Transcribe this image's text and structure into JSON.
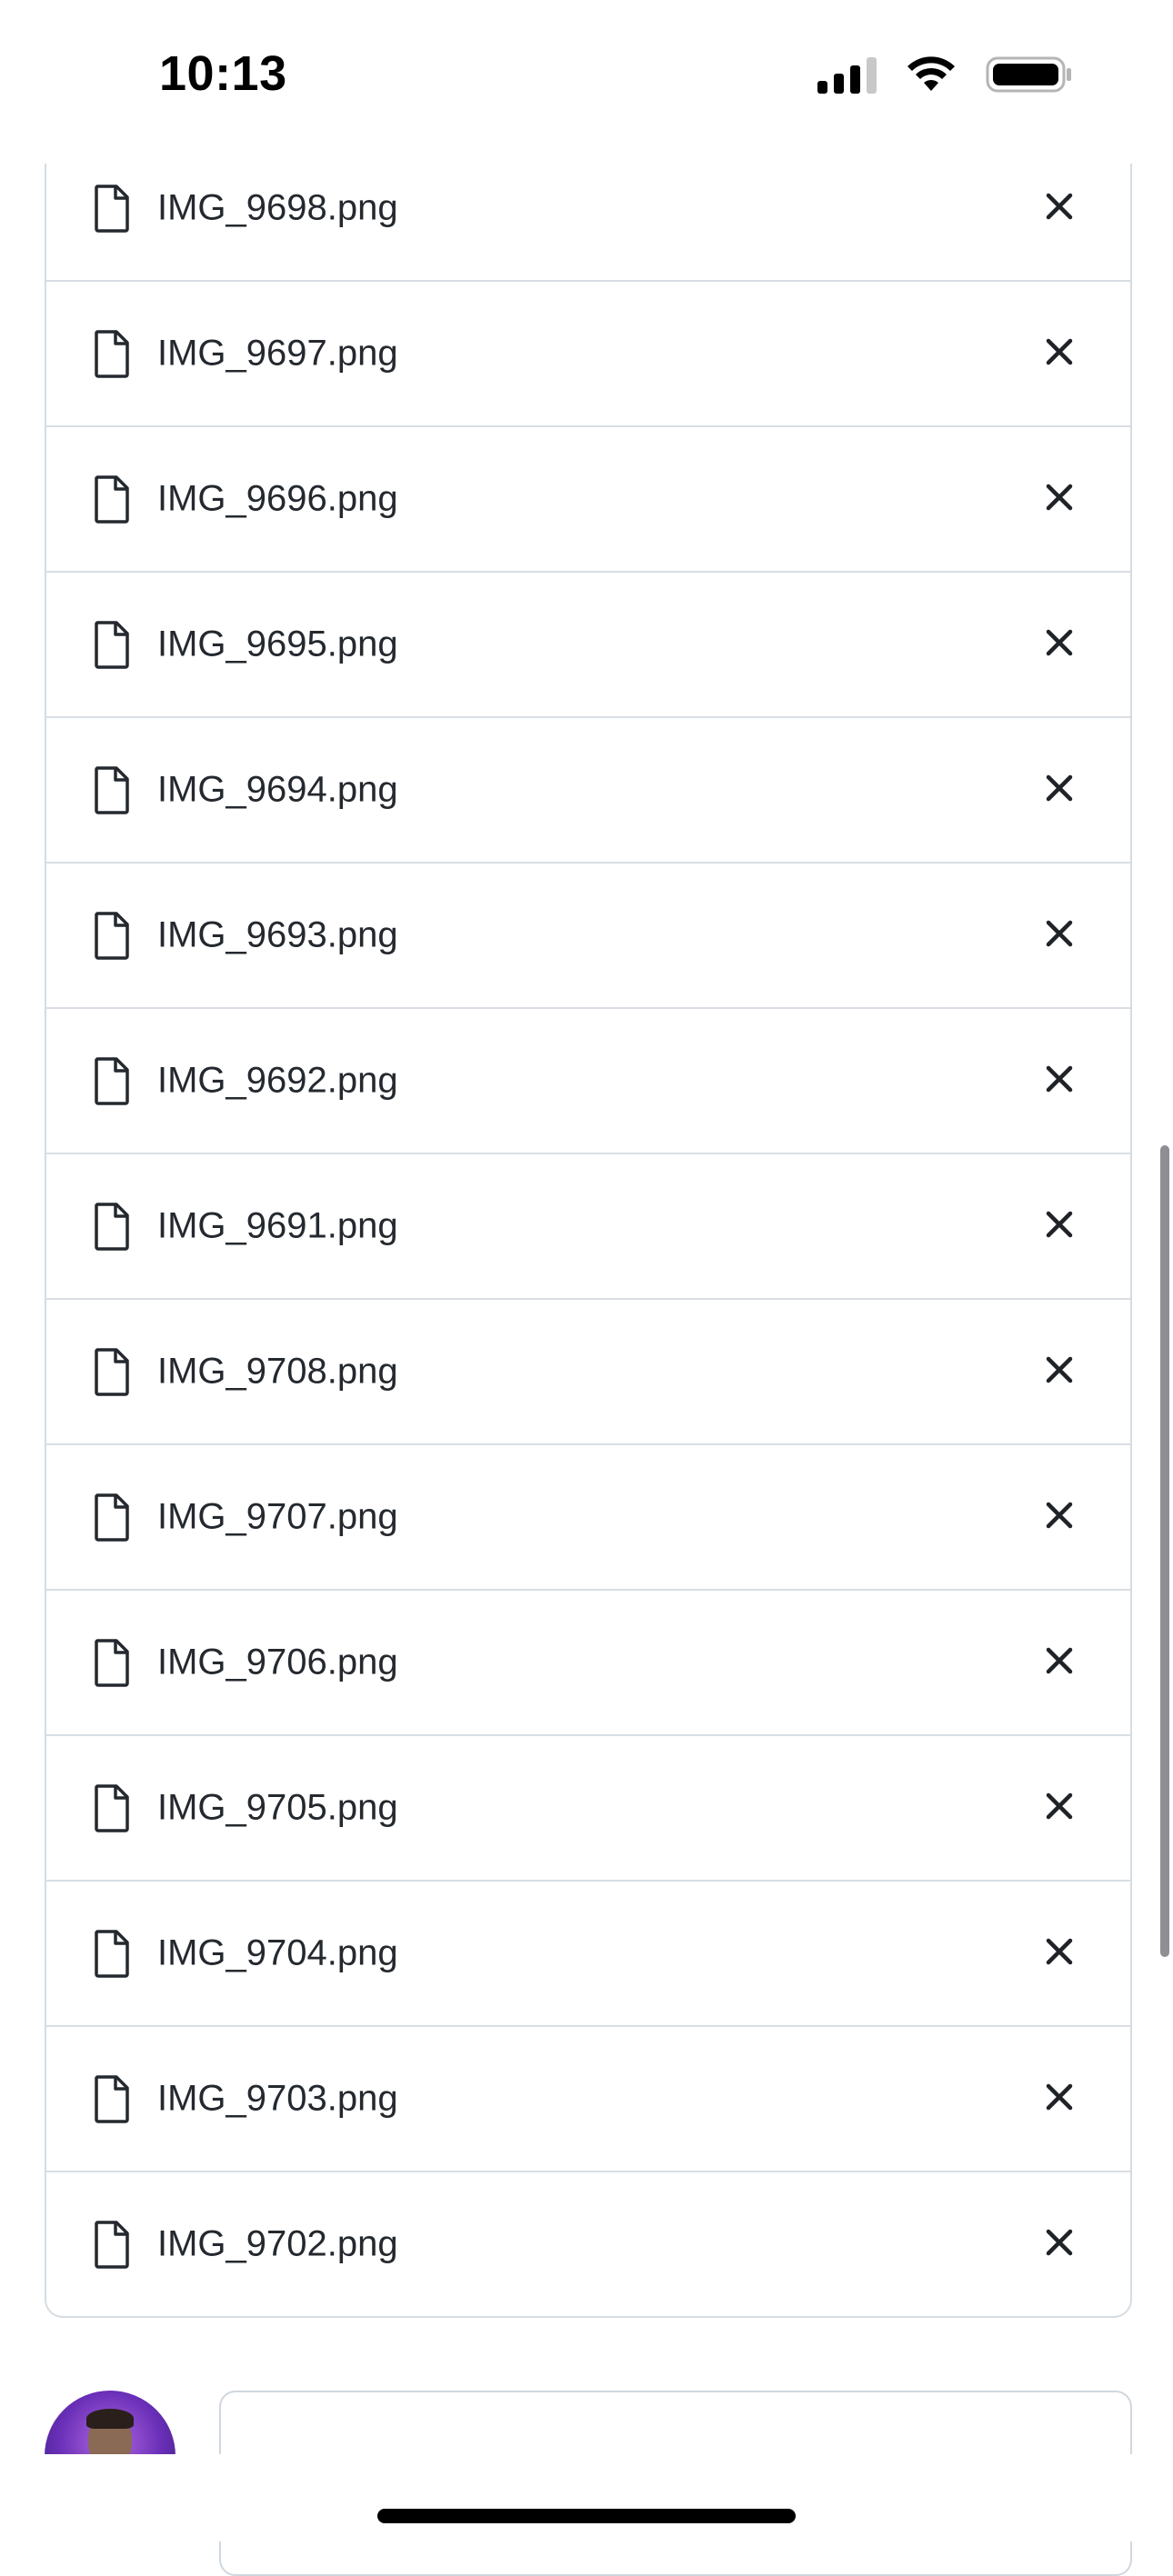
{
  "status_bar": {
    "time": "10:13",
    "icons": [
      "signal-icon",
      "wifi-icon",
      "battery-icon"
    ]
  },
  "attachments": {
    "files": [
      {
        "name": "IMG_9698.png"
      },
      {
        "name": "IMG_9697.png"
      },
      {
        "name": "IMG_9696.png"
      },
      {
        "name": "IMG_9695.png"
      },
      {
        "name": "IMG_9694.png"
      },
      {
        "name": "IMG_9693.png"
      },
      {
        "name": "IMG_9692.png"
      },
      {
        "name": "IMG_9691.png"
      },
      {
        "name": "IMG_9708.png"
      },
      {
        "name": "IMG_9707.png"
      },
      {
        "name": "IMG_9706.png"
      },
      {
        "name": "IMG_9705.png"
      },
      {
        "name": "IMG_9704.png"
      },
      {
        "name": "IMG_9703.png"
      },
      {
        "name": "IMG_9702.png"
      }
    ],
    "file_icon": "file-icon",
    "remove_icon": "close-icon"
  },
  "comment": {
    "avatar_icon": "avatar",
    "input_value": ""
  },
  "colors": {
    "border": "#d8dee4",
    "text": "#24292f",
    "avatar_bg": "#6a2fb8"
  }
}
